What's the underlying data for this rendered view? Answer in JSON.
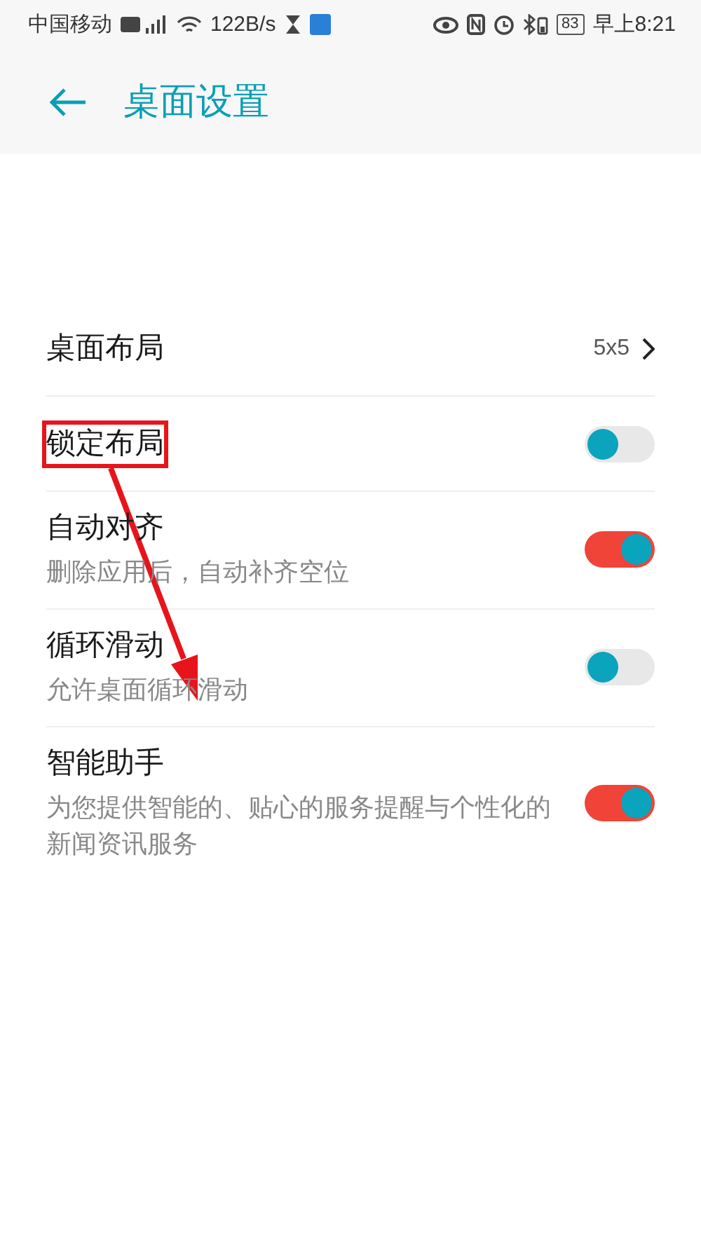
{
  "status_bar": {
    "carrier": "中国移动",
    "speed": "122B/s",
    "battery": "83",
    "time": "早上8:21"
  },
  "header": {
    "title": "桌面设置"
  },
  "settings": [
    {
      "kind": "value",
      "title": "桌面布局",
      "value": "5x5",
      "highlighted": false
    },
    {
      "kind": "toggle",
      "title": "锁定布局",
      "on": false,
      "highlighted": true
    },
    {
      "kind": "toggle",
      "title": "自动对齐",
      "subtitle": "删除应用后，自动补齐空位",
      "on": true,
      "highlighted": false
    },
    {
      "kind": "toggle",
      "title": "循环滑动",
      "subtitle": "允许桌面循环滑动",
      "on": false,
      "highlighted": false
    },
    {
      "kind": "toggle",
      "title": "智能助手",
      "subtitle": "为您提供智能的、贴心的服务提醒与个性化的新闻资讯服务",
      "on": true,
      "highlighted": false
    }
  ],
  "annotations": [
    {
      "kind": "arrow"
    }
  ]
}
